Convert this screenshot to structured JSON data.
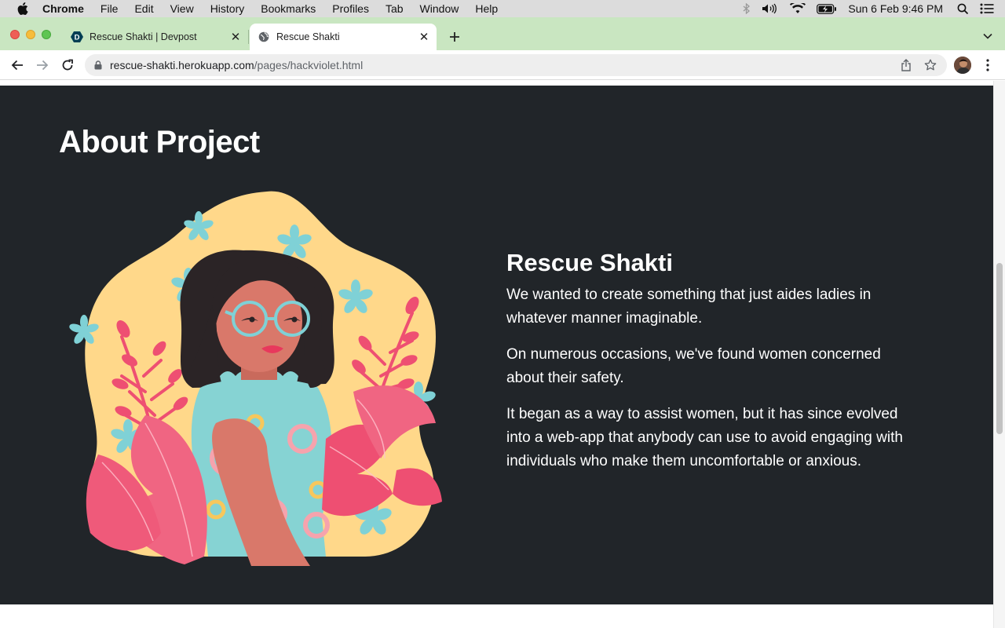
{
  "menubar": {
    "app_name": "Chrome",
    "items": [
      "File",
      "Edit",
      "View",
      "History",
      "Bookmarks",
      "Profiles",
      "Tab",
      "Window",
      "Help"
    ],
    "clock": "Sun 6 Feb  9:46 PM"
  },
  "tabs": [
    {
      "title": "Rescue Shakti | Devpost",
      "favicon": "devpost-icon",
      "favicon_letter": "D",
      "active": false
    },
    {
      "title": "Rescue Shakti",
      "favicon": "globe-icon",
      "active": true
    }
  ],
  "address_bar": {
    "host": "rescue-shakti.herokuapp.com",
    "path": "/pages/hackviolet.html"
  },
  "page": {
    "heading": "About Project",
    "project_title": "Rescue Shakti",
    "paragraphs": [
      "We wanted to create something that just aides ladies in whatever manner imaginable.",
      "On numerous occasions, we've found women concerned about their safety.",
      "It began as a way to assist women, but it has since evolved into a web-app that anybody can use to avoid engaging with individuals who make them uncomfortable or anxious."
    ]
  },
  "colors": {
    "section_bg": "#212529",
    "tabstrip_bg": "#c9e6c1",
    "blob_yellow": "#ffd88a",
    "leaf_pink": "#ee4f72",
    "flower_teal": "#7fd1d6"
  }
}
